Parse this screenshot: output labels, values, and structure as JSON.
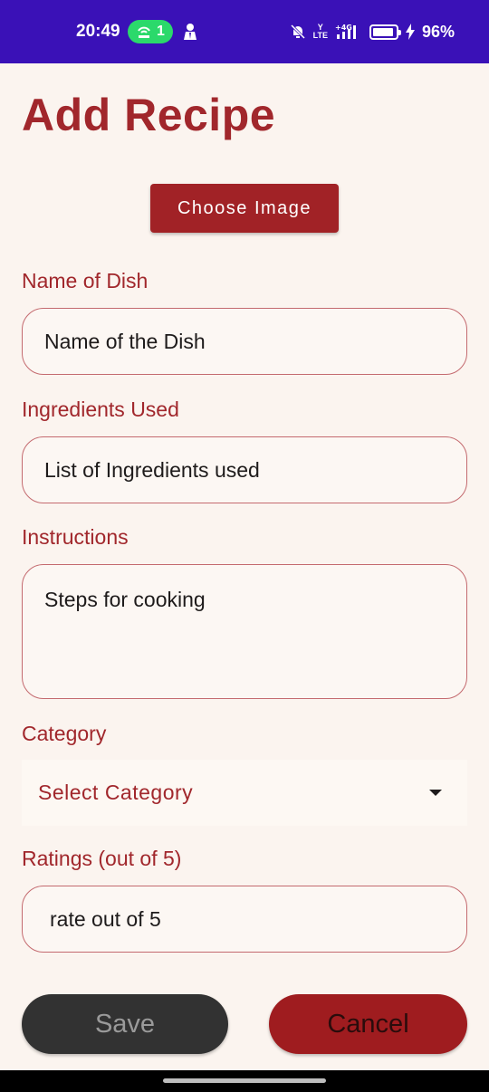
{
  "status_bar": {
    "time": "20:49",
    "hotspot_count": "1",
    "lte_label": "Yo\nLTE",
    "network": "4G",
    "battery": "96%",
    "bg_color": "#3a11b7"
  },
  "page": {
    "title": "Add Recipe",
    "choose_image_label": "Choose Image"
  },
  "form": {
    "name": {
      "label": "Name of Dish",
      "placeholder": "Name of the Dish"
    },
    "ingredients": {
      "label": "Ingredients Used",
      "placeholder": "List of Ingredients used"
    },
    "instructions": {
      "label": "Instructions",
      "placeholder": "Steps for cooking"
    },
    "category": {
      "label": "Category",
      "selected": "Select Category"
    },
    "ratings": {
      "label": "Ratings (out of 5)",
      "placeholder": "rate out of 5"
    }
  },
  "actions": {
    "save_label": "Save",
    "cancel_label": "Cancel"
  },
  "colors": {
    "accent": "#a1272c",
    "background": "#fbf4ef",
    "save_bg": "#323232",
    "cancel_bg": "#9f1c1f"
  }
}
